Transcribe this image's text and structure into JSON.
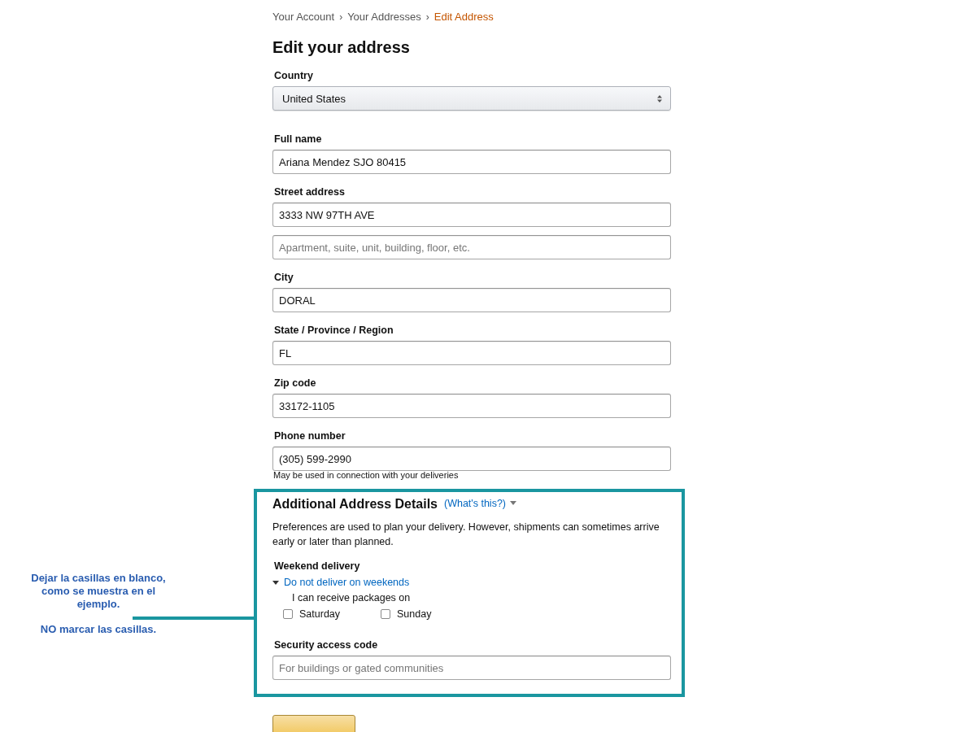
{
  "breadcrumb": {
    "separator": "›",
    "items": [
      {
        "label": "Your Account",
        "selected": false
      },
      {
        "label": "Your Addresses",
        "selected": false
      },
      {
        "label": "Edit Address",
        "selected": true
      }
    ]
  },
  "title": "Edit your address",
  "fields": [
    {
      "kind": "select",
      "label": "Country",
      "inputs": [
        {
          "value": "United States"
        }
      ]
    },
    {
      "kind": "text",
      "label": "Full name",
      "inputs": [
        {
          "value": "Ariana Mendez SJO 80415"
        }
      ]
    },
    {
      "kind": "text",
      "label": "Street address",
      "inputs": [
        {
          "value": "3333 NW 97TH AVE"
        },
        {
          "placeholder": "Apartment, suite, unit, building, floor, etc."
        }
      ]
    },
    {
      "kind": "text",
      "label": "City",
      "inputs": [
        {
          "value": "DORAL"
        }
      ]
    },
    {
      "kind": "text",
      "label": "State / Province / Region",
      "inputs": [
        {
          "value": "FL"
        }
      ]
    },
    {
      "kind": "text",
      "label": "Zip code",
      "inputs": [
        {
          "value": "33172-1105"
        }
      ]
    },
    {
      "kind": "text",
      "label": "Phone number",
      "inputs": [
        {
          "value": "(305) 599-2990"
        }
      ],
      "hint": "May be used in connection with your deliveries"
    }
  ],
  "additional": {
    "title": "Additional Address Details",
    "help_link": "(What's this?)",
    "description": "Preferences are used to plan your delivery. However, shipments can sometimes arrive early or later than planned.",
    "weekend": {
      "label": "Weekend delivery",
      "toggle": {
        "label": "Do not deliver on weekends",
        "expanded": true
      },
      "prompt": "I can receive packages on",
      "days": [
        {
          "label": "Saturday",
          "checked": false
        },
        {
          "label": "Sunday",
          "checked": false
        }
      ]
    },
    "security": {
      "label": "Security access code",
      "placeholder": "For buildings or gated communities"
    }
  },
  "annotation": {
    "lines": [
      "Dejar la casillas en blanco, como se muestra en el ejemplo.",
      "NO marcar las casillas."
    ]
  }
}
